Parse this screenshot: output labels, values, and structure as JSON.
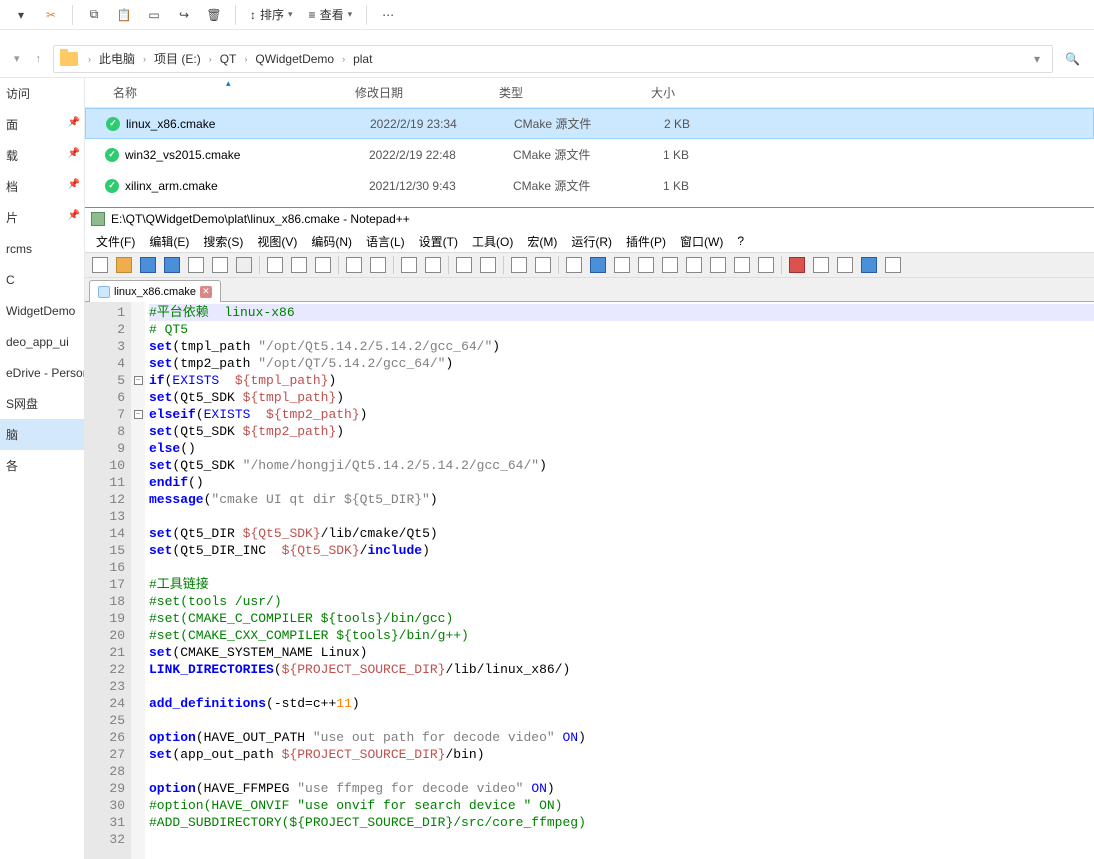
{
  "toolbar": {
    "sort_label": "排序",
    "view_label": "查看"
  },
  "breadcrumb": {
    "segments": [
      "此电脑",
      "项目 (E:)",
      "QT",
      "QWidgetDemo",
      "plat"
    ]
  },
  "sidebar": {
    "items": [
      {
        "label": "访问"
      },
      {
        "label": "面"
      },
      {
        "label": "载"
      },
      {
        "label": "档"
      },
      {
        "label": "片"
      },
      {
        "label": "rcms"
      },
      {
        "label": "C"
      },
      {
        "label": "WidgetDemo"
      },
      {
        "label": "deo_app_ui"
      },
      {
        "label": "eDrive - Person"
      },
      {
        "label": "S网盘"
      },
      {
        "label": "脑"
      },
      {
        "label": "各"
      }
    ]
  },
  "file_header": {
    "name": "名称",
    "date": "修改日期",
    "type": "类型",
    "size": "大小"
  },
  "files": [
    {
      "name": "linux_x86.cmake",
      "date": "2022/2/19 23:34",
      "type": "CMake 源文件",
      "size": "2 KB",
      "selected": true
    },
    {
      "name": "win32_vs2015.cmake",
      "date": "2022/2/19 22:48",
      "type": "CMake 源文件",
      "size": "1 KB",
      "selected": false
    },
    {
      "name": "xilinx_arm.cmake",
      "date": "2021/12/30 9:43",
      "type": "CMake 源文件",
      "size": "1 KB",
      "selected": false
    }
  ],
  "npp": {
    "title": "E:\\QT\\QWidgetDemo\\plat\\linux_x86.cmake - Notepad++",
    "menus": [
      "文件(F)",
      "编辑(E)",
      "搜索(S)",
      "视图(V)",
      "编码(N)",
      "语言(L)",
      "设置(T)",
      "工具(O)",
      "宏(M)",
      "运行(R)",
      "插件(P)",
      "窗口(W)",
      "?"
    ],
    "tab": {
      "label": "linux_x86.cmake"
    },
    "code": {
      "lines": [
        {
          "n": 1,
          "hl": true,
          "html": "<span class='c-comment'>#平台依赖  linux-x86</span>"
        },
        {
          "n": 2,
          "html": "<span class='c-comment'># QT5</span>"
        },
        {
          "n": 3,
          "html": "<span class='c-keyword'>set</span><span class='c-paren'>(</span>tmpl_path <span class='c-string'>\"/opt/Qt5.14.2/5.14.2/gcc_64/\"</span><span class='c-paren'>)</span>"
        },
        {
          "n": 4,
          "html": "<span class='c-keyword'>set</span><span class='c-paren'>(</span>tmp2_path <span class='c-string'>\"/opt/QT/5.14.2/gcc_64/\"</span><span class='c-paren'>)</span>"
        },
        {
          "n": 5,
          "fold": "-",
          "html": "<span class='c-keyword'>if</span><span class='c-paren'>(</span><span class='c-keyword2'>EXISTS</span>  <span class='c-var'>${tmpl_path}</span><span class='c-paren'>)</span>"
        },
        {
          "n": 6,
          "html": "<span class='c-keyword'>set</span><span class='c-paren'>(</span>Qt5_SDK <span class='c-var'>${tmpl_path}</span><span class='c-paren'>)</span>"
        },
        {
          "n": 7,
          "fold": "-",
          "html": "<span class='c-keyword'>elseif</span><span class='c-paren'>(</span><span class='c-keyword2'>EXISTS</span>  <span class='c-var'>${tmp2_path}</span><span class='c-paren'>)</span>"
        },
        {
          "n": 8,
          "html": "<span class='c-keyword'>set</span><span class='c-paren'>(</span>Qt5_SDK <span class='c-var'>${tmp2_path}</span><span class='c-paren'>)</span>"
        },
        {
          "n": 9,
          "html": "<span class='c-keyword'>else</span><span class='c-paren'>()</span>"
        },
        {
          "n": 10,
          "html": "<span class='c-keyword'>set</span><span class='c-paren'>(</span>Qt5_SDK <span class='c-string'>\"/home/hongji/Qt5.14.2/5.14.2/gcc_64/\"</span><span class='c-paren'>)</span>"
        },
        {
          "n": 11,
          "html": "<span class='c-keyword'>endif</span><span class='c-paren'>()</span>"
        },
        {
          "n": 12,
          "html": "<span class='c-keyword'>message</span><span class='c-paren'>(</span><span class='c-string'>\"cmake UI qt dir ${Qt5_DIR}\"</span><span class='c-paren'>)</span>"
        },
        {
          "n": 13,
          "html": ""
        },
        {
          "n": 14,
          "html": "<span class='c-keyword'>set</span><span class='c-paren'>(</span>Qt5_DIR <span class='c-var'>${Qt5_SDK}</span>/lib/cmake/Qt5<span class='c-paren'>)</span>"
        },
        {
          "n": 15,
          "html": "<span class='c-keyword'>set</span><span class='c-paren'>(</span>Qt5_DIR_INC  <span class='c-var'>${Qt5_SDK}</span>/<span class='c-keyword'>include</span><span class='c-paren'>)</span>"
        },
        {
          "n": 16,
          "html": ""
        },
        {
          "n": 17,
          "html": "<span class='c-comment'>#工具链接</span>"
        },
        {
          "n": 18,
          "html": "<span class='c-comment'>#set(tools /usr/)</span>"
        },
        {
          "n": 19,
          "html": "<span class='c-comment'>#set(CMAKE_C_COMPILER ${tools}/bin/gcc)</span>"
        },
        {
          "n": 20,
          "html": "<span class='c-comment'>#set(CMAKE_CXX_COMPILER ${tools}/bin/g++)</span>"
        },
        {
          "n": 21,
          "html": "<span class='c-keyword'>set</span><span class='c-paren'>(</span>CMAKE_SYSTEM_NAME Linux<span class='c-paren'>)</span>"
        },
        {
          "n": 22,
          "html": "<span class='c-keyword'>LINK_DIRECTORIES</span><span class='c-paren'>(</span><span class='c-var'>${PROJECT_SOURCE_DIR}</span>/lib/linux_x86/<span class='c-paren'>)</span>"
        },
        {
          "n": 23,
          "html": ""
        },
        {
          "n": 24,
          "html": "<span class='c-keyword'>add_definitions</span><span class='c-paren'>(</span>-std=c++<span class='c-num'>11</span><span class='c-paren'>)</span>"
        },
        {
          "n": 25,
          "html": ""
        },
        {
          "n": 26,
          "html": "<span class='c-keyword'>option</span><span class='c-paren'>(</span>HAVE_OUT_PATH <span class='c-string'>\"use out path for decode video\"</span> <span class='c-keyword2'>ON</span><span class='c-paren'>)</span>"
        },
        {
          "n": 27,
          "html": "<span class='c-keyword'>set</span><span class='c-paren'>(</span>app_out_path <span class='c-var'>${PROJECT_SOURCE_DIR}</span>/bin<span class='c-paren'>)</span>"
        },
        {
          "n": 28,
          "html": ""
        },
        {
          "n": 29,
          "html": "<span class='c-keyword'>option</span><span class='c-paren'>(</span>HAVE_FFMPEG <span class='c-string'>\"use ffmpeg for decode video\"</span> <span class='c-keyword2'>ON</span><span class='c-paren'>)</span>"
        },
        {
          "n": 30,
          "html": "<span class='c-comment'>#option(HAVE_ONVIF \"use onvif for search device \" ON)</span>"
        },
        {
          "n": 31,
          "html": "<span class='c-comment'>#ADD_SUBDIRECTORY(${PROJECT_SOURCE_DIR}/src/core_ffmpeg)</span>"
        },
        {
          "n": 32,
          "html": ""
        }
      ]
    }
  }
}
